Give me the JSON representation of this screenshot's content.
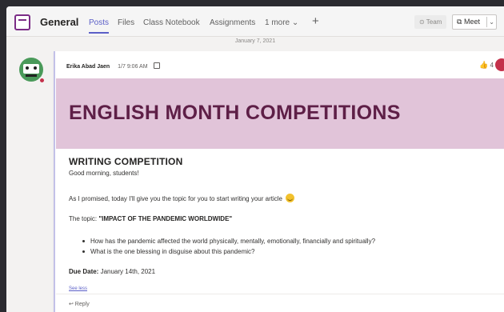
{
  "header": {
    "channel_name": "General",
    "tabs": [
      "Posts",
      "Files",
      "Class Notebook",
      "Assignments",
      "1 more"
    ],
    "plus": "+",
    "team_button": "⊙ Team",
    "meet_button": "Meet"
  },
  "date_separator": "January 7, 2021",
  "post": {
    "author": "Erika Abad Jaen",
    "time": "1/7 9:06 AM",
    "reaction_count": "4",
    "banner_title": "ENGLISH MONTH COMPETITIONS",
    "section_title": "WRITING COMPETITION",
    "greeting": "Good morning, students!",
    "promise_text": "As I promised, today I'll give you the topic for you to start writing your article",
    "topic_label": "The topic: ",
    "topic_value": "\"IMPACT OF THE PANDEMIC WORLDWIDE\"",
    "bullets": [
      "How has the pandemic affected the world physically, mentally, emotionally, financially and spiritually?",
      "What is the one blessing in disguise about this pandemic?"
    ],
    "due_label": "Due Date:",
    "due_value": " January 14th, 2021",
    "see_less": "See less",
    "reply": "↩ Reply"
  },
  "colors": {
    "accent": "#5b5fc7",
    "banner_bg": "#e1c4d9",
    "banner_text": "#5e1f47",
    "presence": "#c4314b"
  },
  "icons": [
    "team-icon",
    "copy-icon",
    "thumbs-up-icon",
    "reply-icon",
    "video-icon",
    "chevron-down-icon",
    "smile-emoji-icon"
  ]
}
